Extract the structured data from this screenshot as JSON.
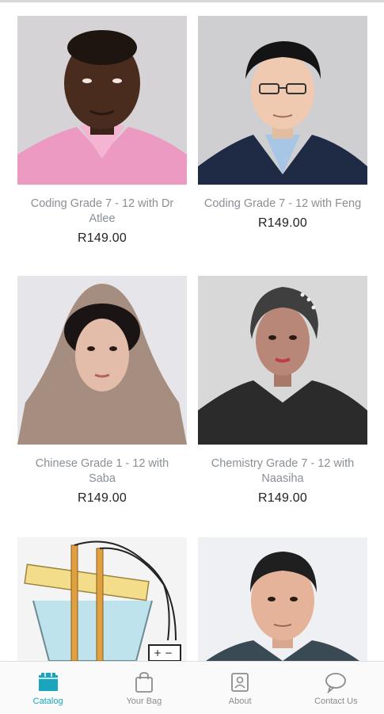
{
  "products": [
    {
      "title": "Coding Grade 7 - 12 with Dr Atlee",
      "price": "R149.00"
    },
    {
      "title": "Coding Grade 7 - 12 with Feng",
      "price": "R149.00"
    },
    {
      "title": "Chinese Grade 1 - 12 with Saba",
      "price": "R149.00"
    },
    {
      "title": "Chemistry Grade 7 - 12 with Naasiha",
      "price": "R149.00"
    }
  ],
  "nav": {
    "catalog": "Catalog",
    "bag": "Your Bag",
    "about": "About",
    "contact": "Contact Us"
  },
  "colors": {
    "accent": "#1aa4bd",
    "inactive": "#8c8c8c"
  }
}
